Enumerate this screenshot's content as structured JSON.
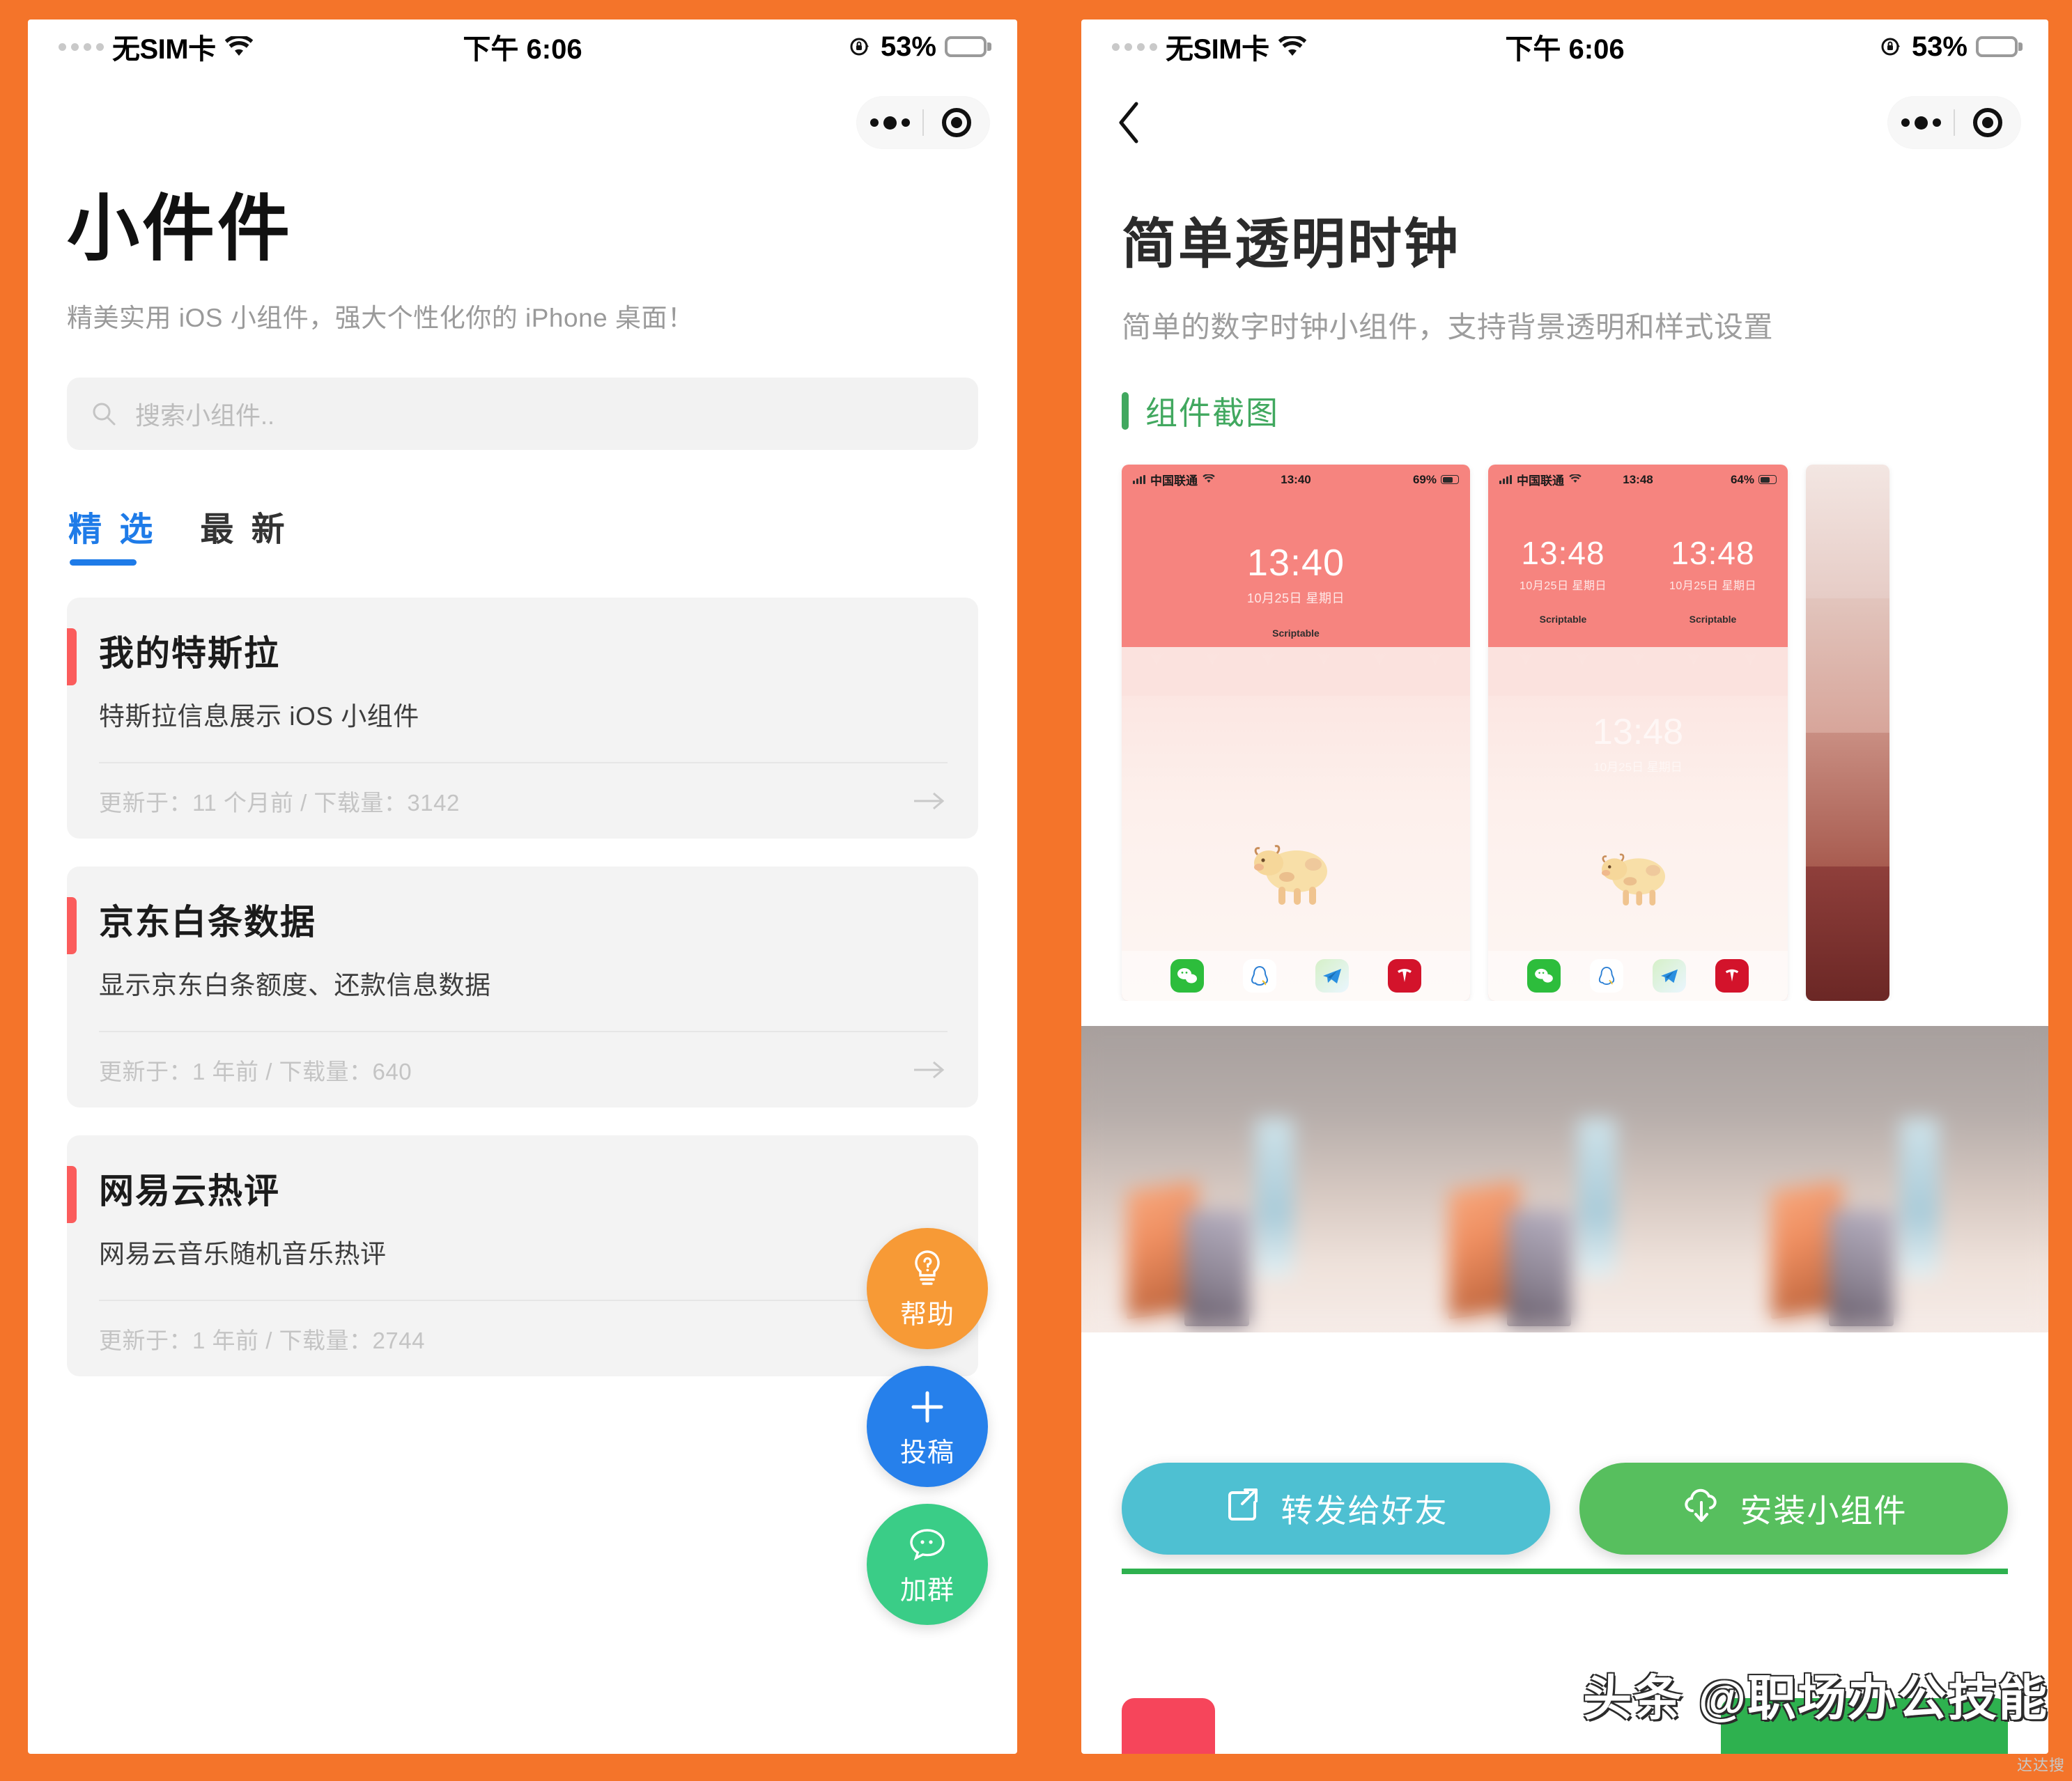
{
  "theme": {
    "frame_orange": "#F4742A",
    "accent_blue": "#1E7BE8",
    "accent_red": "#FB5C5C",
    "accent_green": "#41A85F",
    "battery_yellow": "#FFCC00"
  },
  "status_bar": {
    "carrier": "无SIM卡",
    "wifi_icon": "wifi-icon",
    "time": "下午 6:06",
    "rotation_lock_icon": "rotation-lock-icon",
    "battery_percent": "53%",
    "battery_level": 53
  },
  "capsule": {
    "more_icon": "more-dots-icon",
    "target_icon": "target-circle-icon"
  },
  "home": {
    "title": "小件件",
    "subtitle": "精美实用 iOS 小组件，强大个性化你的 iPhone 桌面！",
    "search": {
      "icon": "search-icon",
      "placeholder": "搜索小组件..",
      "value": ""
    },
    "tabs": [
      {
        "label": "精 选",
        "active": true
      },
      {
        "label": "最 新",
        "active": false
      }
    ],
    "cards": [
      {
        "title": "我的特斯拉",
        "desc": "特斯拉信息展示 iOS 小组件",
        "meta": "更新于：11 个月前 / 下载量：3142",
        "updated": "11 个月前",
        "downloads": "3142",
        "arrow_icon": "arrow-right-icon"
      },
      {
        "title": "京东白条数据",
        "desc": "显示京东白条额度、还款信息数据",
        "meta": "更新于：1 年前 / 下载量：640",
        "updated": "1 年前",
        "downloads": "640",
        "arrow_icon": "arrow-right-icon"
      },
      {
        "title": "网易云热评",
        "desc": "网易云音乐随机音乐热评",
        "meta": "更新于：1 年前 / 下载量：2744",
        "updated": "1 年前",
        "downloads": "2744",
        "arrow_icon": "arrow-right-icon"
      }
    ],
    "fabs": [
      {
        "label": "帮助",
        "icon": "lightbulb-question-icon",
        "color": "#F79A36"
      },
      {
        "label": "投稿",
        "icon": "plus-icon",
        "color": "#2680EB"
      },
      {
        "label": "加群",
        "icon": "chat-bubble-icon",
        "color": "#3ACD87"
      }
    ]
  },
  "detail": {
    "back_icon": "back-chevron-icon",
    "title": "简单透明时钟",
    "subtitle": "简单的数字时钟小组件，支持背景透明和样式设置",
    "section": {
      "title": "组件截图"
    },
    "screenshots": [
      {
        "carrier": "中国联通",
        "time": "13:40",
        "battery": "69%",
        "clock": "13:40",
        "date": "10月25日 星期日",
        "app_label": "Scriptable",
        "widgets": 1
      },
      {
        "carrier": "中国联通",
        "time": "13:48",
        "battery": "64%",
        "clock": "13:48",
        "date": "10月25日 星期日",
        "app_label": "Scriptable",
        "widgets": 2
      },
      {
        "carrier": "",
        "time": "",
        "battery": "",
        "clock": "",
        "date": "",
        "app_label": "",
        "widgets": 0
      }
    ],
    "actions": [
      {
        "label": "转发给好友",
        "icon": "share-box-icon",
        "color": "#4EC0D2"
      },
      {
        "label": "安装小组件",
        "icon": "cloud-download-icon",
        "color": "#57BF5E"
      }
    ]
  },
  "watermark": {
    "text": "头条 @职场办公技能",
    "corner": "达达搜"
  }
}
